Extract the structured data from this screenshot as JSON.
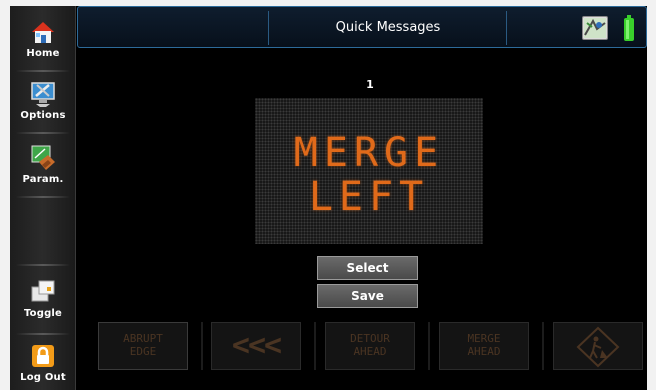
{
  "header": {
    "title": "Quick Messages"
  },
  "sidebar": {
    "items": [
      {
        "label": "Home",
        "icon": "home-icon"
      },
      {
        "label": "Options",
        "icon": "options-icon"
      },
      {
        "label": "Param.",
        "icon": "parameters-icon"
      },
      {
        "label": "Toggle",
        "icon": "toggle-icon"
      },
      {
        "label": "Log Out",
        "icon": "lock-icon"
      }
    ]
  },
  "message": {
    "number": "1",
    "line1": "MERGE",
    "line2": "LEFT",
    "color": "#e06a1a"
  },
  "actions": {
    "select_label": "Select",
    "save_label": "Save"
  },
  "quick_messages": [
    {
      "line1": "ABRUPT",
      "line2": "EDGE"
    },
    {
      "line1": "<<<",
      "line2": ""
    },
    {
      "line1": "DETOUR",
      "line2": "AHEAD"
    },
    {
      "line1": "MERGE",
      "line2": "AHEAD"
    },
    {
      "line1": "",
      "line2": "",
      "icon": "worker-sign-icon"
    }
  ],
  "status": {
    "map_icon": "map-icon",
    "battery_icon": "battery-icon",
    "battery_color": "#39d02b"
  }
}
